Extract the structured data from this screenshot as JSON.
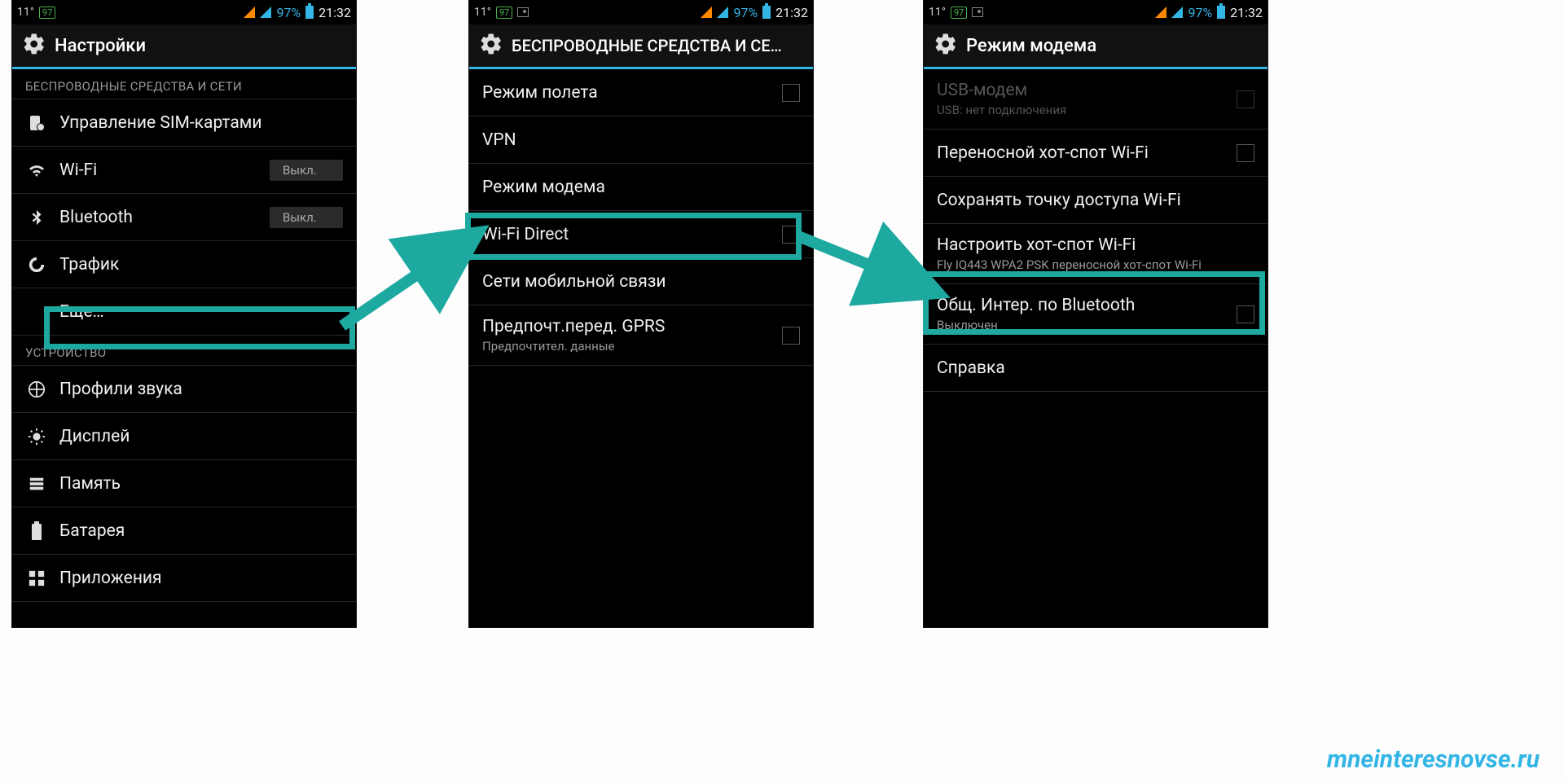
{
  "status": {
    "temp": "11°",
    "badge": "97",
    "battery_pct": "97%",
    "time": "21:32"
  },
  "phone1": {
    "title": "Настройки",
    "section_wireless": "БЕСПРОВОДНЫЕ СРЕДСТВА И СЕТИ",
    "sim": "Управление SIM-картами",
    "wifi": "Wi-Fi",
    "wifi_state": "Выкл.",
    "bt": "Bluetooth",
    "bt_state": "Выкл.",
    "traffic": "Трафик",
    "more": "Еще…",
    "section_device": "УСТРОЙСТВО",
    "sound": "Профили звука",
    "display": "Дисплей",
    "memory": "Память",
    "battery": "Батарея",
    "apps": "Приложения"
  },
  "phone2": {
    "title": "БЕСПРОВОДНЫЕ СРЕДСТВА И СЕ…",
    "airplane": "Режим полета",
    "vpn": "VPN",
    "tether": "Режим модема",
    "wifi_direct": "Wi-Fi Direct",
    "mobile": "Сети мобильной связи",
    "gprs": "Предпочт.перед. GPRS",
    "gprs_sub": "Предпочтител. данные"
  },
  "phone3": {
    "title": "Режим модема",
    "usb": "USB-модем",
    "usb_sub": "USB: нет подключения",
    "hotspot": "Переносной хот-спот Wi-Fi",
    "keep": "Сохранять точку доступа Wi-Fi",
    "configure": "Настроить хот-спот Wi-Fi",
    "configure_sub": "Fly IQ443 WPA2 PSK переносной хот-спот Wi-Fi",
    "bt_share": "Общ. Интер. по Bluetooth",
    "bt_share_sub": "Выключен",
    "help": "Справка"
  },
  "watermark": "mneinteresnovse.ru"
}
